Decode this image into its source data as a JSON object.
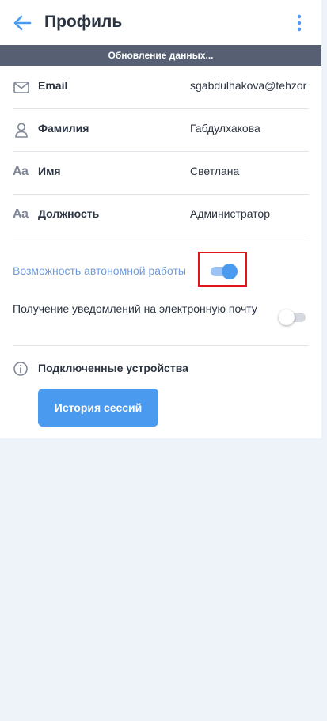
{
  "header": {
    "title": "Профиль",
    "back_icon": "arrow-left-icon",
    "menu_icon": "kebab-menu-icon"
  },
  "status_bar": {
    "text": "Обновление данных..."
  },
  "fields": [
    {
      "icon": "mail-icon",
      "label": "Email",
      "value": "sgabdulhakova@tehzor"
    },
    {
      "icon": "person-icon",
      "label": "Фамилия",
      "value": "Габдулхакова"
    },
    {
      "icon": "text-aa-icon",
      "icon_text": "Aa",
      "label": "Имя",
      "value": "Светлана"
    },
    {
      "icon": "text-aa-icon",
      "icon_text": "Aa",
      "label": "Должность",
      "value": "Администратор"
    }
  ],
  "settings": {
    "offline_mode": {
      "label": "Возможность автономной работы",
      "enabled": true
    },
    "email_notifications": {
      "label": "Получение уведомлений на электронную почту",
      "enabled": false
    }
  },
  "devices": {
    "icon": "info-icon",
    "label": "Подключенные устройства",
    "button_label": "История сессий"
  },
  "colors": {
    "accent": "#4a9af0",
    "status_bar": "#566072",
    "highlight_box": "#e0141c",
    "page_background": "#eef2f9"
  }
}
